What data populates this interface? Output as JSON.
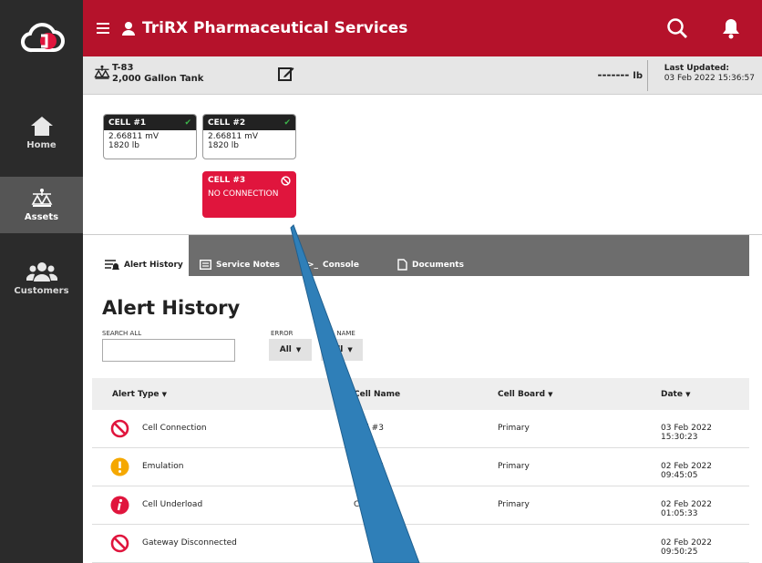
{
  "app": {
    "title": "TriRX Pharmaceutical Services"
  },
  "sidebar": {
    "items": [
      {
        "label": "Home",
        "icon": "home-icon"
      },
      {
        "label": "Assets",
        "icon": "scale-icon",
        "active": true
      },
      {
        "label": "Customers",
        "icon": "customers-icon"
      }
    ]
  },
  "asset": {
    "id": "T-83",
    "name": "2,000 Gallon Tank",
    "weight": "-------",
    "unit": "lb",
    "last_updated_label": "Last Updated:",
    "last_updated": "03 Feb 2022 15:36:57"
  },
  "cells": [
    {
      "name": "CELL #1",
      "value": "2.66811 mV",
      "weight": "1820 lb",
      "status": "ok"
    },
    {
      "name": "CELL #2",
      "value": "2.66811 mV",
      "weight": "1820 lb",
      "status": "ok"
    },
    {
      "name": "CELL #3",
      "value": "NO CONNECTION",
      "status": "error"
    }
  ],
  "tabs": [
    {
      "label": "Alert History",
      "icon": "alert-history-icon",
      "active": true
    },
    {
      "label": "Service Notes",
      "icon": "notes-icon"
    },
    {
      "label": "Console",
      "icon": "console-icon"
    },
    {
      "label": "Documents",
      "icon": "document-icon"
    }
  ],
  "alert_history": {
    "title": "Alert History",
    "search_label": "SEARCH ALL",
    "search_value": "",
    "error_filter": {
      "label": "ERROR",
      "value": "All"
    },
    "cell_filter": {
      "label": "CELL NAME",
      "value": "All"
    },
    "columns": [
      "Alert Type",
      "Cell Name",
      "Cell Board",
      "Date"
    ],
    "rows": [
      {
        "type": "Cell Connection",
        "icon": "no-connection-icon",
        "cell": "Cell #3",
        "board": "Primary",
        "date": "03 Feb 2022 15:30:23"
      },
      {
        "type": "Emulation",
        "icon": "warning-icon",
        "cell": "Cell #3",
        "board": "Primary",
        "date": "02 Feb 2022 09:45:05"
      },
      {
        "type": "Cell Underload",
        "icon": "info-icon",
        "cell": "Cell #3",
        "board": "Primary",
        "date": "02 Feb 2022 01:05:33"
      },
      {
        "type": "Gateway Disconnected",
        "icon": "no-connection-icon",
        "cell": "",
        "board": "",
        "date": "02 Feb 2022 09:50:25"
      }
    ]
  },
  "colors": {
    "brand": "#b5122b",
    "error": "#e0153d",
    "ok": "#3cb44b",
    "warning": "#f5a800",
    "sidebar": "#2b2b2b",
    "pointer": "#2f7fb8"
  }
}
